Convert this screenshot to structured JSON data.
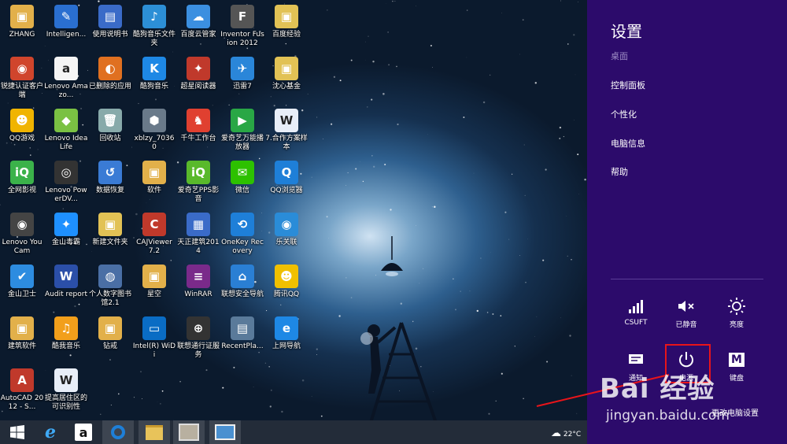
{
  "desktop": {
    "icons": [
      {
        "label": "ZHANG",
        "color": "#e2b04a",
        "glyph": "▣"
      },
      {
        "label": "Intelligen...",
        "color": "#2a6fd0",
        "glyph": "✎"
      },
      {
        "label": "使用说明书",
        "color": "#3a6bc8",
        "glyph": "▤"
      },
      {
        "label": "酷狗音乐文件夹",
        "color": "#2c8fd6",
        "glyph": "♪"
      },
      {
        "label": "百度云管家",
        "color": "#3b8fe0",
        "glyph": "☁"
      },
      {
        "label": "Inventor Fusion 2012",
        "color": "#555",
        "glyph": "F"
      },
      {
        "label": "百度经验",
        "color": "#e2c255",
        "glyph": "▣"
      },
      {
        "label": "锐捷认证客户端",
        "color": "#d0452c",
        "glyph": "◉"
      },
      {
        "label": "Lenovo Amazo...",
        "color": "#f5f5f5",
        "glyph": "a"
      },
      {
        "label": "已删除的应用",
        "color": "#e07020",
        "glyph": "◐"
      },
      {
        "label": "酷狗音乐",
        "color": "#1e88e5",
        "glyph": "K"
      },
      {
        "label": "超星阅读器",
        "color": "#c0392b",
        "glyph": "✦"
      },
      {
        "label": "迅雷7",
        "color": "#2a86d9",
        "glyph": "✈"
      },
      {
        "label": "沈心基金",
        "color": "#e2c255",
        "glyph": "▣"
      },
      {
        "label": "QQ游戏",
        "color": "#f0b400",
        "glyph": "☻"
      },
      {
        "label": "Lenovo IdeaLife",
        "color": "#7ac143",
        "glyph": "◆"
      },
      {
        "label": "回收站",
        "color": "#8aa",
        "glyph": "🗑"
      },
      {
        "label": "xblzy_70360",
        "color": "#6a7a8a",
        "glyph": "⬢"
      },
      {
        "label": "千牛工作台",
        "color": "#e04030",
        "glyph": "♞"
      },
      {
        "label": "爱奇艺万能播放器",
        "color": "#29a745",
        "glyph": "▶"
      },
      {
        "label": "7.合作方案样本",
        "color": "#e8eef8",
        "glyph": "W"
      },
      {
        "label": "全网影视",
        "color": "#3bb24a",
        "glyph": "iQ"
      },
      {
        "label": "Lenovo PowerDV...",
        "color": "#333",
        "glyph": "◎"
      },
      {
        "label": "数据恢复",
        "color": "#3a7bd5",
        "glyph": "↺"
      },
      {
        "label": "软件",
        "color": "#e2b04a",
        "glyph": "▣"
      },
      {
        "label": "爱奇艺PPS影音",
        "color": "#59b92b",
        "glyph": "iQ"
      },
      {
        "label": "微信",
        "color": "#2dc100",
        "glyph": "✉"
      },
      {
        "label": "QQ浏览器",
        "color": "#1e7fd8",
        "glyph": "Q"
      },
      {
        "label": "Lenovo YouCam",
        "color": "#444",
        "glyph": "◉"
      },
      {
        "label": "金山毒霸",
        "color": "#1e90ff",
        "glyph": "✦"
      },
      {
        "label": "新建文件夹",
        "color": "#e2c255",
        "glyph": "▣"
      },
      {
        "label": "CAJViewer 7.2",
        "color": "#c0392b",
        "glyph": "C"
      },
      {
        "label": "天正建筑2014",
        "color": "#3a6bc8",
        "glyph": "▦"
      },
      {
        "label": "OneKey Recovery",
        "color": "#1e7fd8",
        "glyph": "⟲"
      },
      {
        "label": "乐关联",
        "color": "#2a8cd8",
        "glyph": "◉"
      },
      {
        "label": "金山卫士",
        "color": "#2d8ce0",
        "glyph": "✔"
      },
      {
        "label": "Audit report",
        "color": "#2b4fa8",
        "glyph": "W"
      },
      {
        "label": "个人数字图书馆2.1",
        "color": "#4a6fa5",
        "glyph": "◍"
      },
      {
        "label": "星空",
        "color": "#e2b04a",
        "glyph": "▣"
      },
      {
        "label": "WinRAR",
        "color": "#7a2a8a",
        "glyph": "≡"
      },
      {
        "label": "联想安全导航",
        "color": "#2a7fd4",
        "glyph": "⌂"
      },
      {
        "label": "腾讯QQ",
        "color": "#f0c000",
        "glyph": "☻"
      },
      {
        "label": "建筑软件",
        "color": "#e2b04a",
        "glyph": "▣"
      },
      {
        "label": "酷我音乐",
        "color": "#f29f1b",
        "glyph": "♫"
      },
      {
        "label": "钻戒",
        "color": "#e2b04a",
        "glyph": "▣"
      },
      {
        "label": "Intel(R) WiDi",
        "color": "#0a6cc4",
        "glyph": "▭"
      },
      {
        "label": "联想通行证服务",
        "color": "#333",
        "glyph": "⊕"
      },
      {
        "label": "RecentPla...",
        "color": "#5a7a9a",
        "glyph": "▤"
      },
      {
        "label": "上网导航",
        "color": "#1e88e5",
        "glyph": "e"
      },
      {
        "label": "AutoCAD 2012 - S...",
        "color": "#c0392b",
        "glyph": "A"
      },
      {
        "label": "提高居住区的可识别性",
        "color": "#e8eef8",
        "glyph": "W"
      }
    ]
  },
  "charms": {
    "title": "设置",
    "subtitle": "桌面",
    "items": [
      "控制面板",
      "个性化",
      "电脑信息",
      "帮助"
    ],
    "tiles": [
      {
        "label": "CSUFT",
        "icon": "network-icon"
      },
      {
        "label": "已静音",
        "icon": "volume-muted-icon"
      },
      {
        "label": "亮度",
        "icon": "brightness-icon"
      },
      {
        "label": "通知",
        "icon": "notification-icon"
      },
      {
        "label": "电源",
        "icon": "power-icon"
      },
      {
        "label": "键盘",
        "icon": "keyboard-icon",
        "glyph": "M"
      }
    ],
    "change_pc_settings": "更改电脑设置",
    "highlight_color": "#e8141a",
    "panel_color": "#2c0b6b"
  },
  "taskbar": {
    "buttons": [
      "start-icon",
      "ie-icon",
      "amazon-icon",
      "qq-browser-icon",
      "file-explorer-icon",
      "photo-viewer-icon",
      "image-app-icon"
    ],
    "weather": "22°C"
  },
  "watermark": {
    "logo": "Bai 经验",
    "url": "jingyan.baidu.com"
  }
}
